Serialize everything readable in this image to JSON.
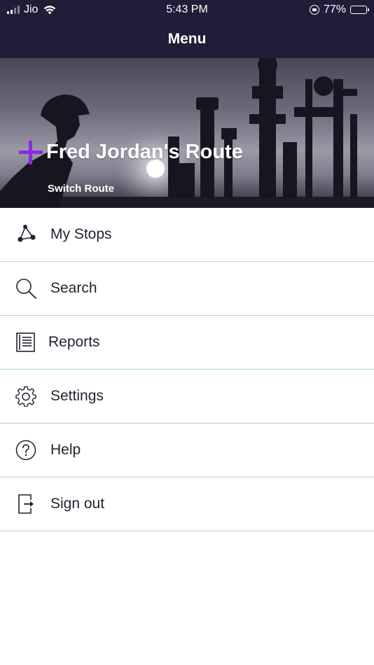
{
  "status_bar": {
    "carrier": "Jio",
    "time": "5:43 PM",
    "battery": "77%",
    "battery_level": 0.77
  },
  "header": {
    "title": "Menu"
  },
  "route": {
    "title": "Fred Jordan's Route",
    "switch_label": "Switch Route",
    "accent_color": "#8a2be2"
  },
  "menu": {
    "items": [
      {
        "label": "My Stops",
        "icon": "route-stops-icon"
      },
      {
        "label": "Search",
        "icon": "search-icon"
      },
      {
        "label": "Reports",
        "icon": "reports-icon"
      },
      {
        "label": "Settings",
        "icon": "gear-icon"
      },
      {
        "label": "Help",
        "icon": "help-icon"
      },
      {
        "label": "Sign out",
        "icon": "sign-out-icon"
      }
    ]
  },
  "colors": {
    "header_bg": "#201d38",
    "divider": "#a9d6dc"
  }
}
